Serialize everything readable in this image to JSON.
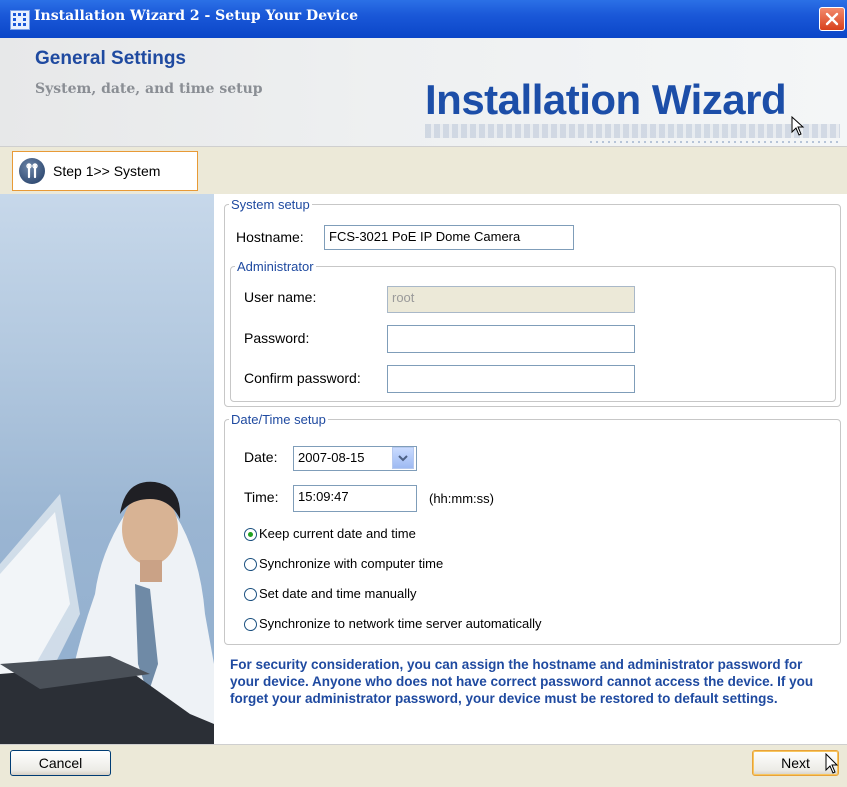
{
  "window": {
    "title": "Installation Wizard 2 - Setup Your Device",
    "close_icon": "close-icon"
  },
  "header": {
    "title": "General Settings",
    "subtitle": "System, date, and time setup",
    "logo_text": "Installation Wizard"
  },
  "tabs": [
    {
      "label": "Step 1>> System",
      "icon": "wizard-tools-icon",
      "active": true
    }
  ],
  "system_setup": {
    "legend": "System setup",
    "hostname_label": "Hostname:",
    "hostname_value": "FCS-3021 PoE IP Dome Camera"
  },
  "administrator": {
    "legend": "Administrator",
    "username_label": "User name:",
    "username_value": "root",
    "password_label": "Password:",
    "password_value": "",
    "confirm_label": "Confirm password:",
    "confirm_value": ""
  },
  "datetime": {
    "legend": "Date/Time setup",
    "date_label": "Date:",
    "date_value": "2007-08-15",
    "time_label": "Time:",
    "time_value": "15:09:47",
    "time_hint": "(hh:mm:ss)",
    "options": [
      {
        "label": "Keep current date and time",
        "checked": true
      },
      {
        "label": "Synchronize with computer time",
        "checked": false
      },
      {
        "label": "Set date and time manually",
        "checked": false
      },
      {
        "label": "Synchronize to network time server automatically",
        "checked": false
      }
    ]
  },
  "notice": "For security consideration, you can assign the hostname and administrator password for your device. Anyone who does not have correct password cannot access the device. If you forget your administrator password, your device must be restored to default settings.",
  "footer": {
    "cancel_label": "Cancel",
    "next_label": "Next"
  },
  "colors": {
    "titlebar": "#0b46c8",
    "accent_blue": "#1f4aa0",
    "dialog_bg": "#ece9d8",
    "tab_border": "#e89a36"
  }
}
